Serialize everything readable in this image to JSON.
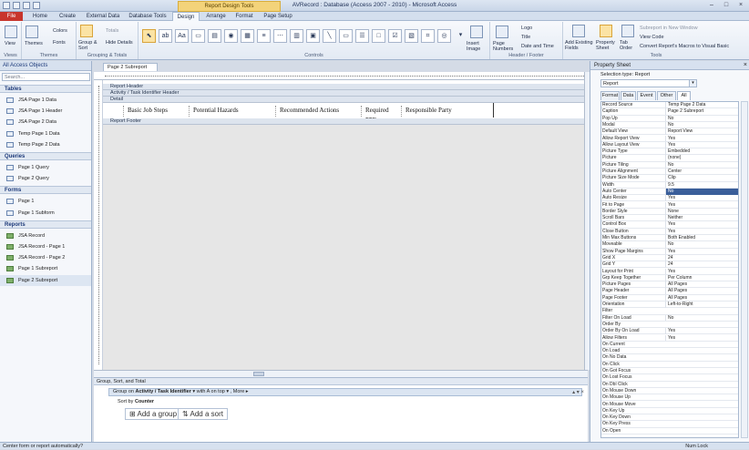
{
  "window": {
    "title": "AVRecord : Database (Access 2007 - 2010) - Microsoft Access",
    "context_tab": "Report Design Tools"
  },
  "tabs": [
    "File",
    "Home",
    "Create",
    "External Data",
    "Database Tools",
    "Design",
    "Arrange",
    "Format",
    "Page Setup"
  ],
  "active_tab": "Design",
  "ribbon": {
    "views": {
      "view": "View",
      "label": "Views"
    },
    "themes": {
      "themes": "Themes",
      "colors": "Colors",
      "fonts": "Fonts",
      "label": "Themes"
    },
    "grouping": {
      "group_sort": "Group & Sort",
      "totals": "Totals",
      "hide_details": "Hide Details",
      "label": "Grouping & Totals"
    },
    "controls": {
      "label": "Controls",
      "insert_image": "Insert Image"
    },
    "header_footer": {
      "page_numbers": "Page Numbers",
      "logo": "Logo",
      "title": "Title",
      "date_time": "Date and Time",
      "label": "Header / Footer"
    },
    "tools": {
      "add_fields": "Add Existing Fields",
      "property_sheet": "Property Sheet",
      "tab_order": "Tab Order",
      "subreport_new_window": "Subreport in New Window",
      "view_code": "View Code",
      "convert_macros": "Convert Report's Macros to Visual Basic",
      "label": "Tools"
    }
  },
  "nav": {
    "header": "All Access Objects",
    "search_placeholder": "Search...",
    "sections": [
      {
        "name": "Tables",
        "items": [
          "JSA Page 1 Data",
          "JSA Page 1 Header",
          "JSA Page 2 Data",
          "Temp Page 1 Data",
          "Temp Page 2 Data"
        ]
      },
      {
        "name": "Queries",
        "items": [
          "Page 1 Query",
          "Page 2 Query"
        ]
      },
      {
        "name": "Forms",
        "items": [
          "Page 1",
          "Page 1 Subform"
        ]
      },
      {
        "name": "Reports",
        "items": [
          "JSA Record",
          "JSA Record - Page 1",
          "JSA Record - Page 2",
          "Page 1 Subreport",
          "Page 2 Subreport"
        ]
      }
    ]
  },
  "document": {
    "tab": "Page 2 Subreport",
    "bands": [
      "Report Header",
      "Activity / Task Identifier Header",
      "Detail",
      "Report Footer"
    ],
    "labels": [
      "Basic Job Steps",
      "Potential Hazards",
      "Recommended Actions",
      "Required PPE",
      "Responsible Party"
    ]
  },
  "gst": {
    "title": "Group, Sort, and Total",
    "group_prefix": "Group on",
    "group_field": "Activity / Task Identifier",
    "group_opts": "with A on top",
    "more": "More",
    "sort_prefix": "Sort by",
    "sort_field": "Counter",
    "add_group": "Add a group",
    "add_sort": "Add a sort"
  },
  "property_sheet": {
    "title": "Property Sheet",
    "selection_type": "Selection type:  Report",
    "selected": "Report",
    "tabs": [
      "Format",
      "Data",
      "Event",
      "Other",
      "All"
    ],
    "active_tab": "All",
    "rows": [
      [
        "Record Source",
        "Temp Page 2 Data"
      ],
      [
        "Caption",
        "Page 2 Subreport"
      ],
      [
        "Pop Up",
        "No"
      ],
      [
        "Modal",
        "No"
      ],
      [
        "Default View",
        "Report View"
      ],
      [
        "Allow Report View",
        "Yes"
      ],
      [
        "Allow Layout View",
        "Yes"
      ],
      [
        "Picture Type",
        "Embedded"
      ],
      [
        "Picture",
        "(none)"
      ],
      [
        "Picture Tiling",
        "No"
      ],
      [
        "Picture Alignment",
        "Center"
      ],
      [
        "Picture Size Mode",
        "Clip"
      ],
      [
        "Width",
        "9.5"
      ],
      [
        "Auto Center",
        "No"
      ],
      [
        "Auto Resize",
        "Yes"
      ],
      [
        "Fit to Page",
        "Yes"
      ],
      [
        "Border Style",
        "None"
      ],
      [
        "Scroll Bars",
        "Neither"
      ],
      [
        "Control Box",
        "Yes"
      ],
      [
        "Close Button",
        "Yes"
      ],
      [
        "Min Max Buttons",
        "Both Enabled"
      ],
      [
        "Moveable",
        "No"
      ],
      [
        "Show Page Margins",
        "Yes"
      ],
      [
        "Grid X",
        "24"
      ],
      [
        "Grid Y",
        "24"
      ],
      [
        "Layout for Print",
        "Yes"
      ],
      [
        "Grp Keep Together",
        "Per Column"
      ],
      [
        "Picture Pages",
        "All Pages"
      ],
      [
        "Page Header",
        "All Pages"
      ],
      [
        "Page Footer",
        "All Pages"
      ],
      [
        "Orientation",
        "Left-to-Right"
      ],
      [
        "Filter",
        ""
      ],
      [
        "Filter On Load",
        "No"
      ],
      [
        "Order By",
        ""
      ],
      [
        "Order By On Load",
        "Yes"
      ],
      [
        "Allow Filters",
        "Yes"
      ],
      [
        "On Current",
        ""
      ],
      [
        "On Load",
        ""
      ],
      [
        "On No Data",
        ""
      ],
      [
        "On Click",
        ""
      ],
      [
        "On Got Focus",
        ""
      ],
      [
        "On Lost Focus",
        ""
      ],
      [
        "On Dbl Click",
        ""
      ],
      [
        "On Mouse Down",
        ""
      ],
      [
        "On Mouse Up",
        ""
      ],
      [
        "On Mouse Move",
        ""
      ],
      [
        "On Key Up",
        ""
      ],
      [
        "On Key Down",
        ""
      ],
      [
        "On Key Press",
        ""
      ],
      [
        "On Open",
        ""
      ]
    ],
    "highlight_row": 13
  },
  "status": {
    "left": "Center form or report automatically?",
    "right": "Num Lock"
  },
  "colors": {
    "file_tab": "#c8352c",
    "selection": "#3a5e9a",
    "context_tab": "#f3d37a"
  }
}
